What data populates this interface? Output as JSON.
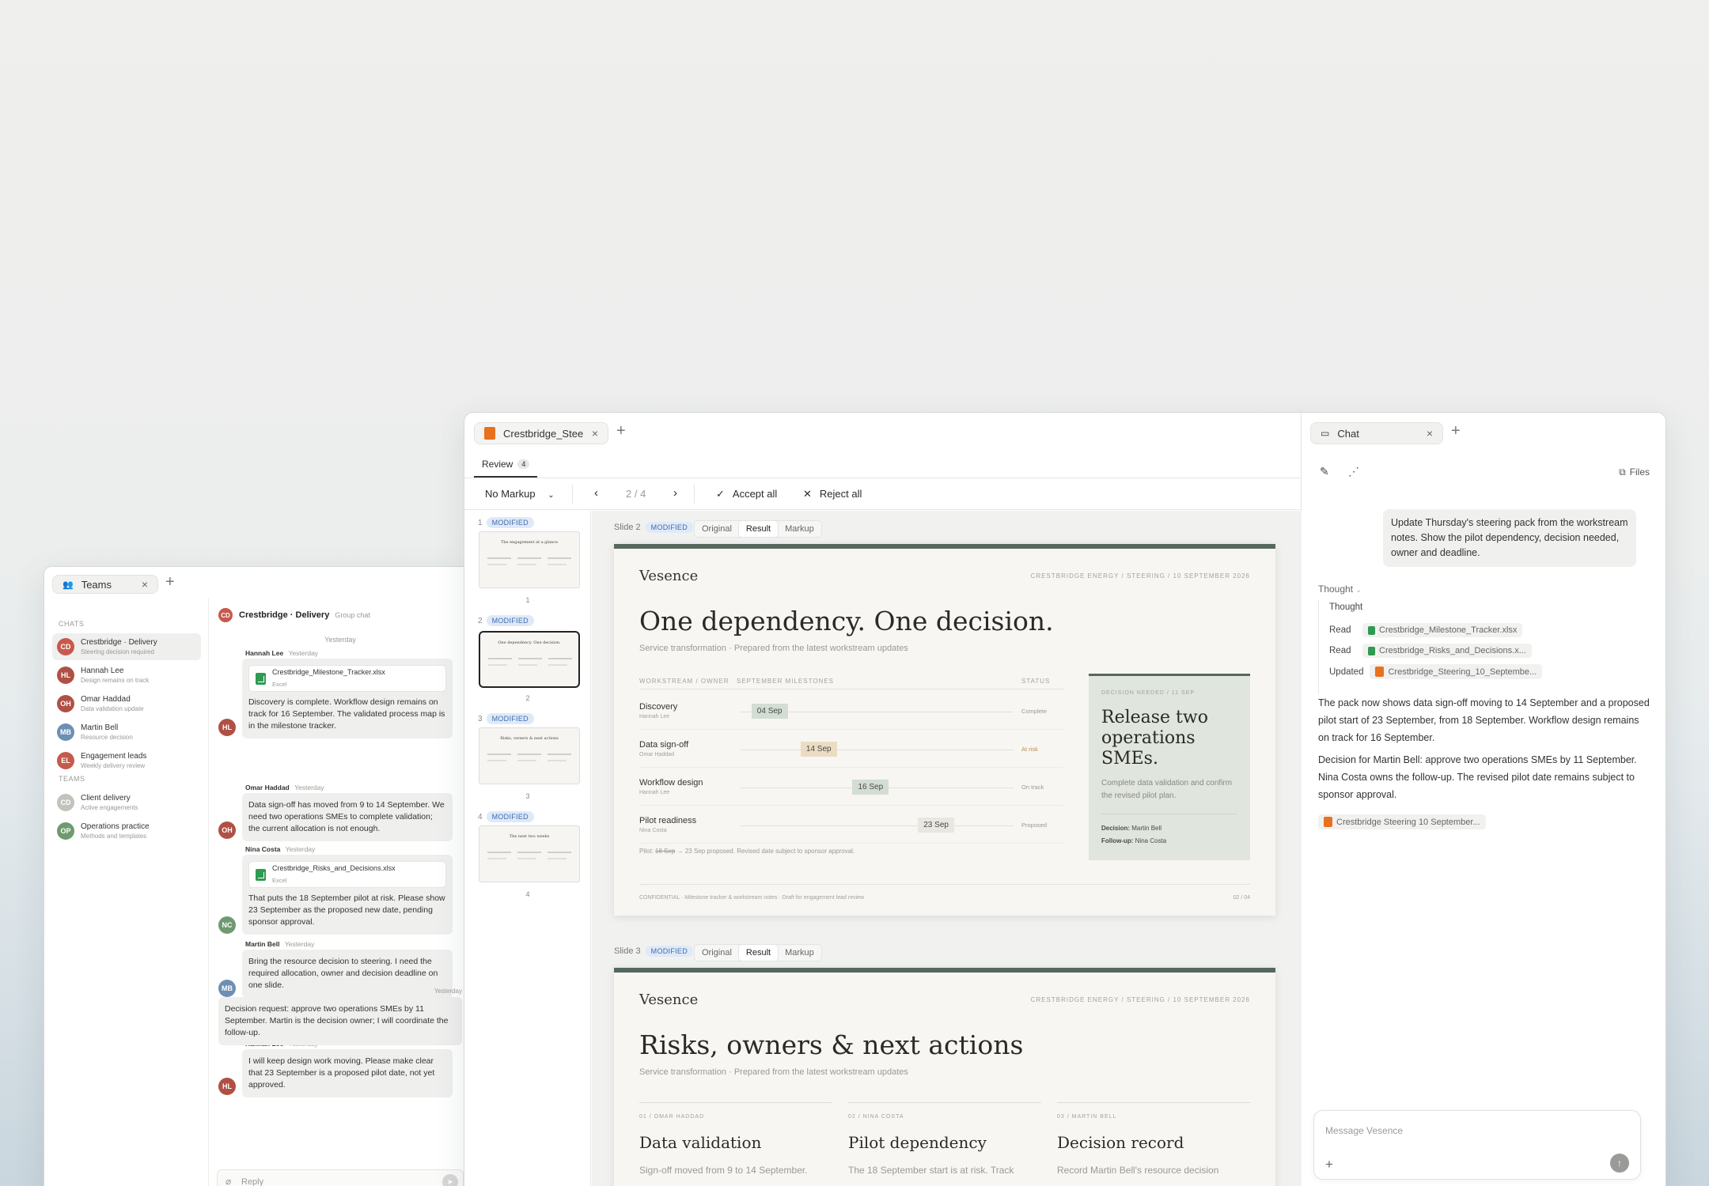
{
  "teams": {
    "tab_label": "Teams",
    "chats_header": "CHATS",
    "teams_header": "TEAMS",
    "chats": [
      {
        "initials": "CD",
        "name": "Crestbridge · Delivery",
        "sub": "Steering decision required",
        "color": "#c9584c"
      },
      {
        "initials": "HL",
        "name": "Hannah Lee",
        "sub": "Design remains on track",
        "color": "#b05045"
      },
      {
        "initials": "OH",
        "name": "Omar Haddad",
        "sub": "Data validation update",
        "color": "#b05045"
      },
      {
        "initials": "MB",
        "name": "Martin Bell",
        "sub": "Resource decision",
        "color": "#6e8fb5"
      },
      {
        "initials": "EL",
        "name": "Engagement leads",
        "sub": "Weekly delivery review",
        "color": "#c65a4c"
      }
    ],
    "teams": [
      {
        "initials": "CD",
        "name": "Client delivery",
        "sub": "Active engagements",
        "color": "#c3c3bd"
      },
      {
        "initials": "OP",
        "name": "Operations practice",
        "sub": "Methods and templates",
        "color": "#6f9a70"
      }
    ],
    "conversation": {
      "initials": "CD",
      "title": "Crestbridge · Delivery",
      "subtitle": "Group chat",
      "date_divider": "Yesterday",
      "messages": [
        {
          "initials": "HL",
          "author": "Hannah Lee",
          "time": "Yesterday",
          "file": "Crestbridge_Milestone_Tracker.xlsx",
          "file_type": "Excel",
          "text": "Discovery is complete. Workflow design remains on track for 16 September. The validated process map is in the milestone tracker.",
          "color": "#b05045"
        },
        {
          "initials": "OH",
          "author": "Omar Haddad",
          "time": "Yesterday",
          "text": "Data sign-off has moved from 9 to 14 September. We need two operations SMEs to complete validation; the current allocation is not enough.",
          "color": "#b05045"
        },
        {
          "initials": "NC",
          "author": "Nina Costa",
          "time": "Yesterday",
          "file": "Crestbridge_Risks_and_Decisions.xlsx",
          "file_type": "Excel",
          "text": "That puts the 18 September pilot at risk. Please show 23 September as the proposed new date, pending sponsor approval.",
          "color": "#6f9a70"
        },
        {
          "initials": "MB",
          "author": "Martin Bell",
          "time": "Yesterday",
          "text": "Bring the resource decision to steering. I need the required allocation, owner and decision deadline on one slide.",
          "color": "#6e8fb5"
        },
        {
          "initials": "HL",
          "author": "Hannah Lee",
          "time": "Yesterday",
          "text": "I will keep design work moving. Please make clear that 23 September is a proposed pilot date, not yet approved.",
          "color": "#b05045"
        }
      ],
      "own_message": {
        "time": "Yesterday",
        "text": "Decision request: approve two operations SMEs by 11 September. Martin is the decision owner; I will coordinate the follow-up."
      },
      "reply_placeholder": "Reply"
    }
  },
  "editor": {
    "tab_label": "Crestbridge_Stee",
    "review_tab": "Review",
    "review_count": "4",
    "markup_select": "No Markup",
    "pager": "2 / 4",
    "accept_all": "Accept all",
    "reject_all": "Reject all",
    "thumbnails": [
      {
        "num": "1",
        "status": "MODIFIED",
        "label": "1",
        "title": "The engagement at a glance"
      },
      {
        "num": "2",
        "status": "MODIFIED",
        "label": "2",
        "title": "One dependency. One decision."
      },
      {
        "num": "3",
        "status": "MODIFIED",
        "label": "3",
        "title": "Risks, owners & next actions"
      },
      {
        "num": "4",
        "status": "MODIFIED",
        "label": "4",
        "title": "The next two weeks"
      }
    ],
    "view_modes": [
      "Original",
      "Result",
      "Markup"
    ],
    "slide2": {
      "label": "Slide 2",
      "status": "MODIFIED",
      "brand": "Vesence",
      "header_right": "CRESTBRIDGE ENERGY / STEERING / 10 SEPTEMBER 2026",
      "title": "One dependency. One decision.",
      "subtitle": "Service transformation · Prepared from the latest workstream updates",
      "col_workstream": "WORKSTREAM / OWNER",
      "col_milestones": "SEPTEMBER MILESTONES",
      "col_status": "STATUS",
      "rows": [
        {
          "name": "Discovery",
          "owner": "Hannah Lee",
          "date": "04 Sep",
          "status": "Complete",
          "pos": 0.04,
          "bg": "#d3ddd3"
        },
        {
          "name": "Data sign-off",
          "owner": "Omar Haddad",
          "date": "14 Sep",
          "status": "At risk",
          "pos": 0.22,
          "bg": "#ecdcc4",
          "status_color": "#c08a4a"
        },
        {
          "name": "Workflow design",
          "owner": "Hannah Lee",
          "date": "16 Sep",
          "status": "On track",
          "pos": 0.41,
          "bg": "#d3ddd3"
        },
        {
          "name": "Pilot readiness",
          "owner": "Nina Costa",
          "date": "23 Sep",
          "status": "Proposed",
          "pos": 0.65,
          "bg": "#e8e7e1"
        }
      ],
      "footnote_prefix": "Pilot: ",
      "footnote_strike": "18 Sep",
      "footnote_rest": " → 23 Sep proposed. Revised date subject to sponsor approval.",
      "decision_caption": "DECISION NEEDED / 11 SEP",
      "decision_title": "Release two operations SMEs.",
      "decision_body": "Complete data validation and confirm the revised pilot plan.",
      "decision_label": "Decision:",
      "decision_owner": "Martin Bell",
      "followup_label": "Follow-up:",
      "followup_owner": "Nina Costa",
      "footer_left": "CONFIDENTIAL · Milestone tracker & workstream notes · Draft for engagement lead review",
      "footer_right": "02 / 04"
    },
    "slide3": {
      "label": "Slide 3",
      "status": "MODIFIED",
      "brand": "Vesence",
      "header_right": "CRESTBRIDGE ENERGY / STEERING / 10 SEPTEMBER 2026",
      "title": "Risks, owners & next actions",
      "subtitle": "Service transformation · Prepared from the latest workstream updates",
      "cols": [
        {
          "caption": "01 / OMAR HADDAD",
          "title": "Data validation",
          "body": "Sign-off moved from 9 to 14 September."
        },
        {
          "caption": "02 / NINA COSTA",
          "title": "Pilot dependency",
          "body": "The 18 September start is at risk. Track"
        },
        {
          "caption": "03 / MARTIN BELL",
          "title": "Decision record",
          "body": "Record Martin Bell's resource decision"
        }
      ]
    }
  },
  "chat": {
    "tab_label": "Chat",
    "files_label": "Files",
    "user_message": "Update Thursday's steering pack from the workstream notes. Show the pilot dependency, decision needed, owner and deadline.",
    "thought_toggle": "Thought",
    "steps": [
      {
        "verb": "Thought",
        "file": ""
      },
      {
        "verb": "Read",
        "file": "Crestbridge_Milestone_Tracker.xlsx",
        "kind": "xls"
      },
      {
        "verb": "Read",
        "file": "Crestbridge_Risks_and_Decisions.x...",
        "kind": "xls"
      },
      {
        "verb": "Updated",
        "file": "Crestbridge_Steering_10_Septembe...",
        "kind": "ppt"
      }
    ],
    "answer_p1": "The pack now shows data sign-off moving to 14 September and a proposed pilot start of 23 September, from 18 September. Workflow design remains on track for 16 September.",
    "answer_p2": "Decision for Martin Bell: approve two operations SMEs by 11 September. Nina Costa owns the follow-up. The revised pilot date remains subject to sponsor approval.",
    "result_file": "Crestbridge Steering 10 September...",
    "input_placeholder": "Message Vesence"
  }
}
